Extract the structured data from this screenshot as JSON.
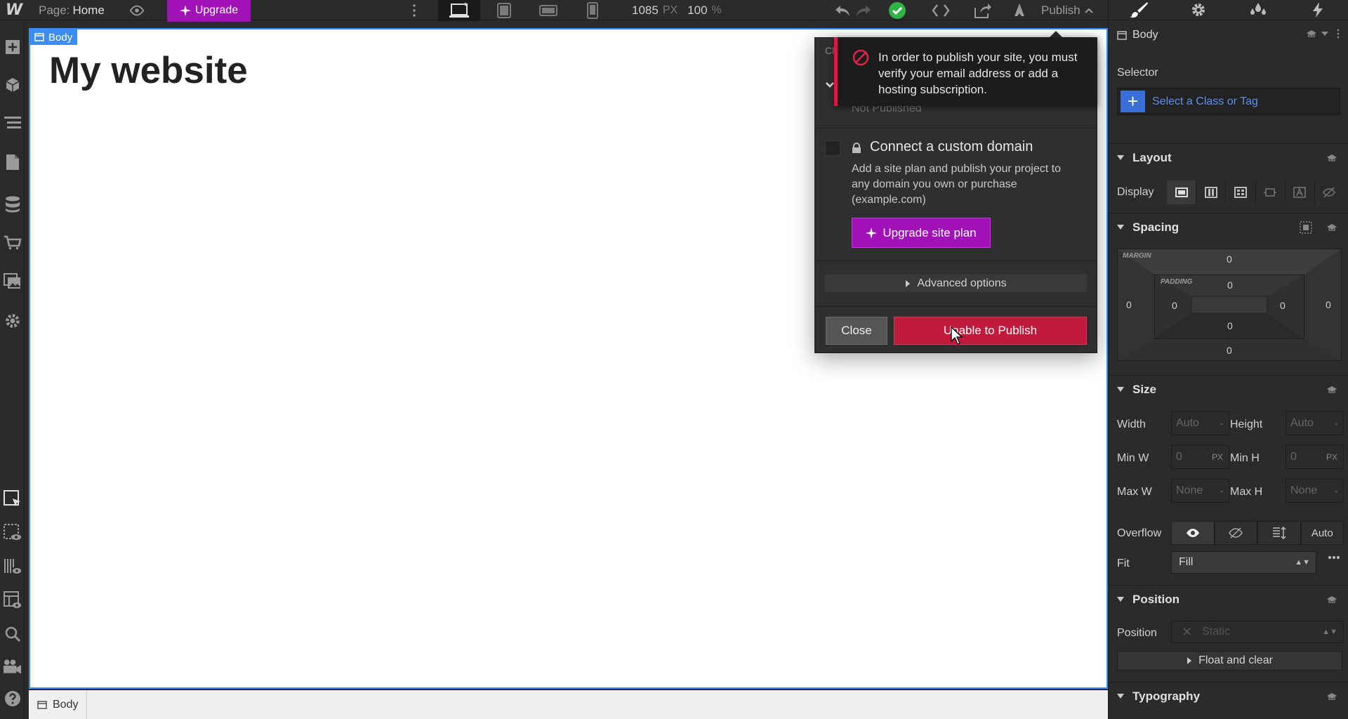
{
  "topbar": {
    "logo": "W",
    "page_prefix": "Page:",
    "page_name": "Home",
    "upgrade_label": "Upgrade",
    "width_value": "1085",
    "width_unit": "PX",
    "zoom_value": "100",
    "zoom_unit": "%",
    "publish_label": "Publish"
  },
  "canvas": {
    "body_tag": "Body",
    "site_title": "My website"
  },
  "breadcrumb": {
    "items": [
      "Body"
    ]
  },
  "publish_popup": {
    "hidden_row_text": "Cl",
    "not_published": "Not Published",
    "error_message": "In order to publish your site, you must verify your email address or add a hosting subscription.",
    "domain_title": "Connect a custom domain",
    "domain_description": "Add a site plan and publish your project to any domain you own or purchase (example.com)",
    "upgrade_plan_label": "Upgrade site plan",
    "advanced_options": "Advanced options",
    "close_label": "Close",
    "unable_label": "Unable to Publish"
  },
  "style_panel": {
    "element": "Body",
    "selector_label": "Selector",
    "selector_placeholder": "Select a Class or Tag",
    "layout": {
      "title": "Layout",
      "display_label": "Display"
    },
    "spacing": {
      "title": "Spacing",
      "margin_label": "MARGIN",
      "padding_label": "PADDING",
      "margin_top": "0",
      "margin_right": "0",
      "margin_bottom": "0",
      "margin_left": "0",
      "padding_top": "0",
      "padding_right": "0",
      "padding_bottom": "0",
      "padding_left": "0"
    },
    "size": {
      "title": "Size",
      "width_label": "Width",
      "width_value": "Auto",
      "height_label": "Height",
      "height_value": "Auto",
      "minw_label": "Min W",
      "minw_value": "0",
      "minw_unit": "PX",
      "minh_label": "Min H",
      "minh_value": "0",
      "minh_unit": "PX",
      "maxw_label": "Max W",
      "maxw_value": "None",
      "maxh_label": "Max H",
      "maxh_value": "None",
      "unit_dash": "-",
      "overflow_label": "Overflow",
      "overflow_auto": "Auto",
      "fit_label": "Fit",
      "fit_value": "Fill"
    },
    "position": {
      "title": "Position",
      "position_label": "Position",
      "position_value": "Static",
      "float_label": "Float and clear"
    },
    "typography": {
      "title": "Typography"
    }
  },
  "colors": {
    "accent_blue": "#3b8cf3",
    "upgrade_purple": "#a012b8",
    "error_red": "#c21a3c",
    "success_green": "#2fb344"
  }
}
